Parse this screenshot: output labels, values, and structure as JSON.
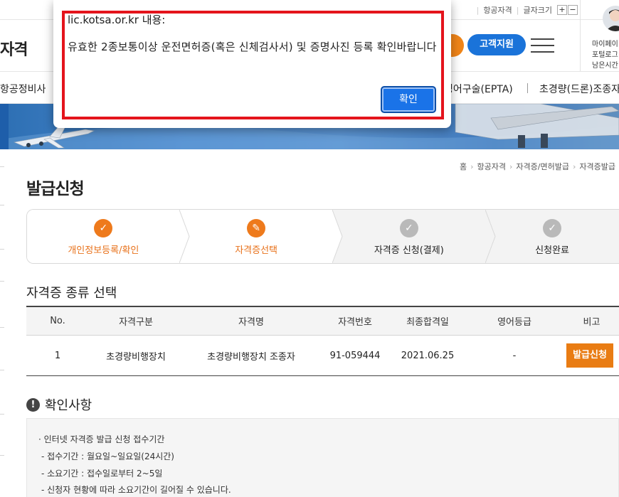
{
  "header": {
    "util_links": [
      "항공자격"
    ],
    "font_size_label": "글자크기",
    "font_size_plus": "+",
    "font_size_minus": "−",
    "brand_title": "자격",
    "support_label": "고객지원",
    "user_lines": [
      "마이페이",
      "포털로그",
      "남은시간"
    ]
  },
  "nav": {
    "items": [
      "항공정비사",
      "영어구술(EPTA)",
      "초경량(드론)조종자"
    ]
  },
  "breadcrumb": [
    "홈",
    "항공자격",
    "자격증/면허발급",
    "자격증발급"
  ],
  "page_title": "발급신청",
  "steps": [
    {
      "label": "개인정보등록/확인",
      "state": "done",
      "icon": "check-icon"
    },
    {
      "label": "자격증선택",
      "state": "done",
      "icon": "pencil-icon"
    },
    {
      "label": "자격증 신청(결제)",
      "state": "todo",
      "icon": "check-icon"
    },
    {
      "label": "신청완료",
      "state": "todo",
      "icon": "check-icon"
    }
  ],
  "section_title": "자격증 종류 선택",
  "table": {
    "headers": [
      "No.",
      "자격구분",
      "자격명",
      "자격번호",
      "최종합격일",
      "영어등급",
      "비고"
    ],
    "rows": [
      {
        "no": "1",
        "category": "초경량비행장치",
        "name": "초경량비행장치 조종자",
        "number": "91-059444",
        "pass_date": "2021.06.25",
        "english": "-",
        "action": "발급신청"
      }
    ]
  },
  "notice": {
    "title": "확인사항",
    "lines": [
      "· 인터넷 자격증 발급 신청 접수기간",
      "- 접수기간 : 월요일~일요일(24시간)",
      "- 소요기간 : 접수일로부터 2~5일",
      "- 신청자 현황에 따라 소요기간이 길어질 수 있습니다."
    ]
  },
  "dialog": {
    "origin": "lic.kotsa.or.kr 내용:",
    "message": "유효한 2종보통이상 운전면허증(혹은 신체검사서) 및 증명사진 등록 확인바랍니다",
    "ok_label": "확인"
  },
  "colors": {
    "accent_orange": "#ee7a1c",
    "support_blue": "#1a73d9",
    "dialog_button_blue": "#1a73e8",
    "highlight_red": "#e4141c"
  }
}
